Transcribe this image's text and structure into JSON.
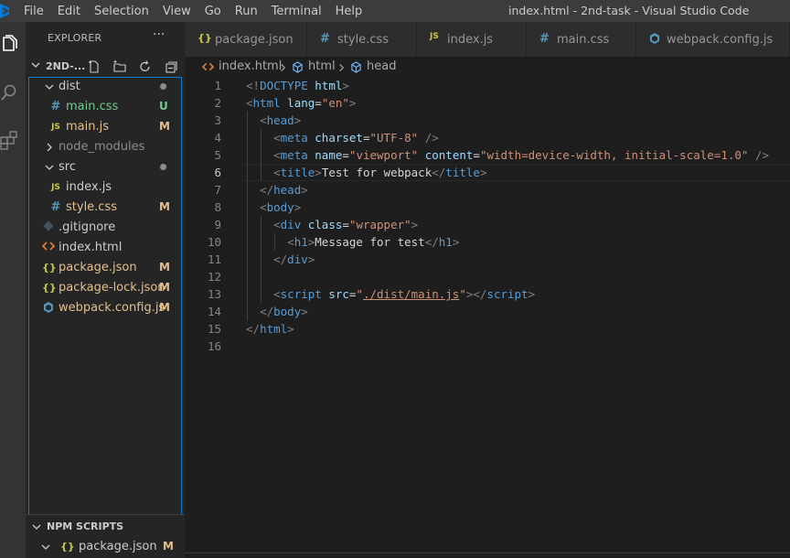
{
  "window": {
    "title": "index.html - 2nd-task - Visual Studio Code",
    "menu": [
      "File",
      "Edit",
      "Selection",
      "View",
      "Go",
      "Run",
      "Terminal",
      "Help"
    ]
  },
  "activity_bar": {
    "items": [
      "files-icon",
      "search-icon",
      "extensions-icon"
    ]
  },
  "sidebar": {
    "header": "EXPLORER",
    "more_actions": "···",
    "root_folder": "2ND-...",
    "tree": [
      {
        "label": "dist",
        "type": "folder",
        "expanded": true,
        "status": "dot",
        "depth": 0
      },
      {
        "label": "main.css",
        "type": "css",
        "status": "U",
        "depth": 1,
        "color": "#73c991"
      },
      {
        "label": "main.js",
        "type": "js",
        "status": "M",
        "depth": 1,
        "color": "#e2c08d"
      },
      {
        "label": "node_modules",
        "type": "folder",
        "expanded": false,
        "status": "",
        "depth": 0,
        "color": "#8c8c8c"
      },
      {
        "label": "src",
        "type": "folder",
        "expanded": true,
        "status": "dot",
        "depth": 0
      },
      {
        "label": "index.js",
        "type": "js",
        "status": "",
        "depth": 1,
        "color": "#cccccc"
      },
      {
        "label": "style.css",
        "type": "css",
        "status": "M",
        "depth": 1,
        "color": "#e2c08d"
      },
      {
        "label": ".gitignore",
        "type": "git",
        "status": "",
        "depth": 0,
        "color": "#cccccc"
      },
      {
        "label": "index.html",
        "type": "html",
        "status": "",
        "depth": 0,
        "color": "#cccccc"
      },
      {
        "label": "package.json",
        "type": "json",
        "status": "M",
        "depth": 0,
        "color": "#e2c08d"
      },
      {
        "label": "package-lock.json",
        "type": "json",
        "status": "M",
        "depth": 0,
        "color": "#e2c08d"
      },
      {
        "label": "webpack.config.js",
        "type": "webpack",
        "status": "M",
        "depth": 0,
        "color": "#e2c08d"
      }
    ],
    "npm_scripts": {
      "header": "NPM SCRIPTS",
      "item": {
        "label": "package.json",
        "status": "M"
      }
    }
  },
  "tabs": [
    {
      "label": "package.json",
      "icon": "{}",
      "type": "json"
    },
    {
      "label": "style.css",
      "icon": "#",
      "type": "css"
    },
    {
      "label": "index.js",
      "icon": "JS",
      "type": "js"
    },
    {
      "label": "main.css",
      "icon": "#",
      "type": "css"
    },
    {
      "label": "webpack.config.js",
      "icon": "webpack",
      "type": "webpack"
    }
  ],
  "breadcrumb": [
    "index.html",
    "html",
    "head"
  ],
  "editor": {
    "active_line": 6,
    "lines": [
      [
        [
          "punc",
          "<!"
        ],
        [
          "tag",
          "DOCTYPE"
        ],
        [
          "txt",
          " "
        ],
        [
          "attr",
          "html"
        ],
        [
          "punc",
          ">"
        ]
      ],
      [
        [
          "punc",
          "<"
        ],
        [
          "tag",
          "html"
        ],
        [
          "txt",
          " "
        ],
        [
          "attr",
          "lang"
        ],
        [
          "txt",
          "="
        ],
        [
          "str",
          "\"en\""
        ],
        [
          "punc",
          ">"
        ]
      ],
      [
        [
          "txt",
          "  "
        ],
        [
          "punc",
          "<"
        ],
        [
          "tag",
          "head"
        ],
        [
          "punc",
          ">"
        ]
      ],
      [
        [
          "txt",
          "    "
        ],
        [
          "punc",
          "<"
        ],
        [
          "tag",
          "meta"
        ],
        [
          "txt",
          " "
        ],
        [
          "attr",
          "charset"
        ],
        [
          "txt",
          "="
        ],
        [
          "str",
          "\"UTF-8\""
        ],
        [
          "txt",
          " "
        ],
        [
          "punc",
          "/>"
        ]
      ],
      [
        [
          "txt",
          "    "
        ],
        [
          "punc",
          "<"
        ],
        [
          "tag",
          "meta"
        ],
        [
          "txt",
          " "
        ],
        [
          "attr",
          "name"
        ],
        [
          "txt",
          "="
        ],
        [
          "str",
          "\"viewport\""
        ],
        [
          "txt",
          " "
        ],
        [
          "attr",
          "content"
        ],
        [
          "txt",
          "="
        ],
        [
          "str",
          "\"width=device-width, initial-scale=1.0\""
        ],
        [
          "txt",
          " "
        ],
        [
          "punc",
          "/>"
        ]
      ],
      [
        [
          "txt",
          "    "
        ],
        [
          "punc",
          "<"
        ],
        [
          "tag",
          "title"
        ],
        [
          "punc",
          ">"
        ],
        [
          "txt",
          "Test for webpack"
        ],
        [
          "punc",
          "</"
        ],
        [
          "tag",
          "title"
        ],
        [
          "punc",
          ">"
        ]
      ],
      [
        [
          "txt",
          "  "
        ],
        [
          "punc",
          "</"
        ],
        [
          "tag",
          "head"
        ],
        [
          "punc",
          ">"
        ]
      ],
      [
        [
          "txt",
          "  "
        ],
        [
          "punc",
          "<"
        ],
        [
          "tag",
          "body"
        ],
        [
          "punc",
          ">"
        ]
      ],
      [
        [
          "txt",
          "    "
        ],
        [
          "punc",
          "<"
        ],
        [
          "tag",
          "div"
        ],
        [
          "txt",
          " "
        ],
        [
          "attr",
          "class"
        ],
        [
          "txt",
          "="
        ],
        [
          "str",
          "\"wrapper\""
        ],
        [
          "punc",
          ">"
        ]
      ],
      [
        [
          "txt",
          "      "
        ],
        [
          "punc",
          "<"
        ],
        [
          "tag",
          "h1"
        ],
        [
          "punc",
          ">"
        ],
        [
          "txt",
          "Message for test"
        ],
        [
          "punc",
          "</"
        ],
        [
          "tag",
          "h1"
        ],
        [
          "punc",
          ">"
        ]
      ],
      [
        [
          "txt",
          "    "
        ],
        [
          "punc",
          "</"
        ],
        [
          "tag",
          "div"
        ],
        [
          "punc",
          ">"
        ]
      ],
      [
        [
          "txt",
          ""
        ]
      ],
      [
        [
          "txt",
          "    "
        ],
        [
          "punc",
          "<"
        ],
        [
          "tag",
          "script"
        ],
        [
          "txt",
          " "
        ],
        [
          "attr",
          "src"
        ],
        [
          "txt",
          "="
        ],
        [
          "str",
          "\""
        ],
        [
          "link",
          "./dist/main.js"
        ],
        [
          "str",
          "\""
        ],
        [
          "punc",
          "></"
        ],
        [
          "tag",
          "script"
        ],
        [
          "punc",
          ">"
        ]
      ],
      [
        [
          "txt",
          "  "
        ],
        [
          "punc",
          "</"
        ],
        [
          "tag",
          "body"
        ],
        [
          "punc",
          ">"
        ]
      ],
      [
        [
          "punc",
          "</"
        ],
        [
          "tag",
          "html"
        ],
        [
          "punc",
          ">"
        ]
      ],
      [
        [
          "txt",
          ""
        ]
      ]
    ]
  },
  "colors": {
    "modified": "#e2c08d",
    "untracked": "#73c991",
    "css_icon": "#519aba",
    "js_icon": "#cbcb41",
    "json_icon": "#cbcb41",
    "html_icon": "#e37933",
    "git_icon": "#41535b",
    "webpack_icon": "#519aba",
    "focus_border": "#007fd4"
  }
}
